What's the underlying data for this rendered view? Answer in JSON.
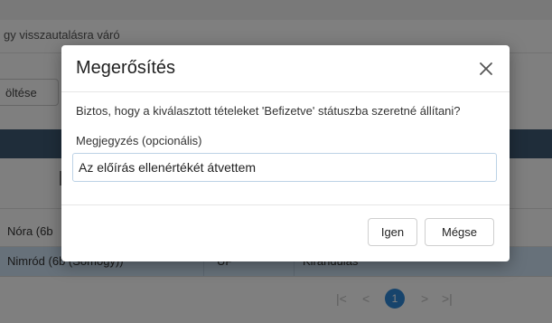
{
  "background": {
    "subtitle": "gy visszautalásra váró",
    "action_button_label": "öltése",
    "rows": [
      {
        "name": "Nóra (6b",
        "type": "",
        "status": ""
      },
      {
        "name": "Nimród (6b (Somogy))",
        "type": "UP",
        "status": "Kirándulás"
      }
    ],
    "pager": {
      "first": "|<",
      "prev": "<",
      "current": "1",
      "next": ">",
      "last": ">|"
    }
  },
  "dialog": {
    "title": "Megerősítés",
    "message": "Biztos, hogy a kiválasztott tételeket 'Befizetve' státuszba szeretné állítani?",
    "note_label": "Megjegyzés (opcionális)",
    "note_value": "Az előírás ellenértékét átvettem",
    "yes_label": "Igen",
    "no_label": "Mégse"
  },
  "colors": {
    "table_header": "#3f5b74",
    "selected_row": "#cfe3f5",
    "pager_active": "#2f88d8",
    "overlay": "rgba(0,0,0,0.5)"
  },
  "icons": {
    "close": "close-icon"
  }
}
